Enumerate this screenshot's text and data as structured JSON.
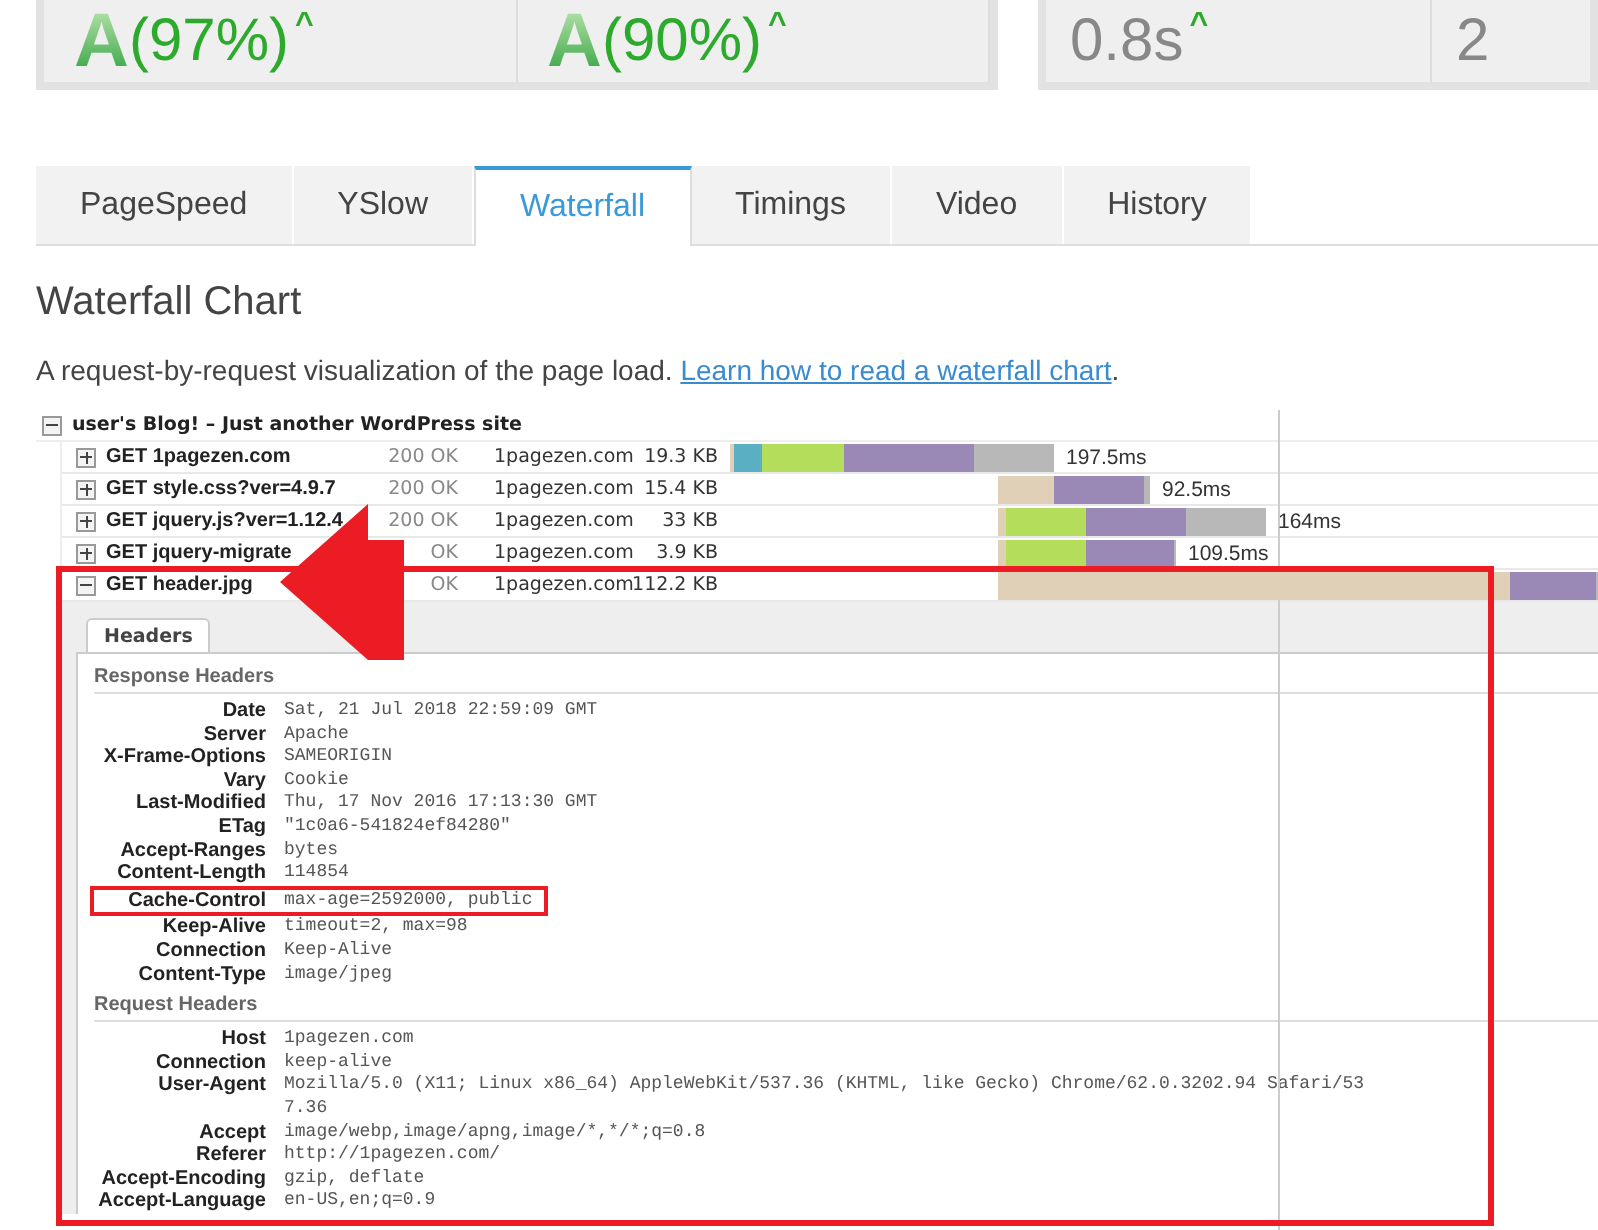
{
  "scores": [
    {
      "kind": "grade",
      "grade": "A",
      "value": "(97%)",
      "trend": "^"
    },
    {
      "kind": "grade",
      "grade": "A",
      "value": "(90%)",
      "trend": "^"
    },
    {
      "kind": "metric",
      "value": "0.8s",
      "trend": "^"
    },
    {
      "kind": "metric",
      "value": "2"
    }
  ],
  "tabs": [
    {
      "label": "PageSpeed",
      "selected": false
    },
    {
      "label": "YSlow",
      "selected": false
    },
    {
      "label": "Waterfall",
      "selected": true
    },
    {
      "label": "Timings",
      "selected": false
    },
    {
      "label": "Video",
      "selected": false
    },
    {
      "label": "History",
      "selected": false
    }
  ],
  "title": "Waterfall Chart",
  "description": {
    "text": "A request-by-request visualization of the page load. ",
    "link": "Learn how to read a waterfall chart",
    "after": "."
  },
  "waterfall": {
    "page": {
      "title": "user's Blog! – Just another WordPress site",
      "expanded": true
    },
    "rows": [
      {
        "name": "GET 1pagezen.com",
        "status": "200 OK",
        "domain": "1pagezen.com",
        "size": "19.3 KB",
        "duration": "197.5ms",
        "expanded": false
      },
      {
        "name": "GET style.css?ver=4.9.7",
        "status": "200 OK",
        "domain": "1pagezen.com",
        "size": "15.4 KB",
        "duration": "92.5ms",
        "expanded": false
      },
      {
        "name": "GET jquery.js?ver=1.12.4",
        "status": "200 OK",
        "domain": "1pagezen.com",
        "size": "33 KB",
        "duration": "164ms",
        "expanded": false
      },
      {
        "name": "GET jquery-migrate",
        "status": "OK",
        "domain": "1pagezen.com",
        "size": "3.9 KB",
        "duration": "109.5ms",
        "expanded": false
      },
      {
        "name": "GET header.jpg",
        "status": "OK",
        "domain": "1pagezen.com",
        "size": "112.2 KB",
        "expanded": true
      }
    ],
    "details": {
      "tabs": [
        {
          "label": "Headers",
          "selected": true
        }
      ],
      "sections": [
        {
          "title": "Response Headers",
          "headers": [
            {
              "name": "Date",
              "value": "Sat, 21 Jul 2018 22:59:09 GMT",
              "highlighted": false
            },
            {
              "name": "Server",
              "value": "Apache",
              "highlighted": false
            },
            {
              "name": "X-Frame-Options",
              "value": "SAMEORIGIN",
              "highlighted": false
            },
            {
              "name": "Vary",
              "value": "Cookie",
              "highlighted": false
            },
            {
              "name": "Last-Modified",
              "value": "Thu, 17 Nov 2016 17:13:30 GMT",
              "highlighted": false
            },
            {
              "name": "ETag",
              "value": "\"1c0a6-541824ef84280\"",
              "highlighted": false
            },
            {
              "name": "Accept-Ranges",
              "value": "bytes",
              "highlighted": false
            },
            {
              "name": "Content-Length",
              "value": "114854",
              "highlighted": false
            },
            {
              "name": "Cache-Control",
              "value": "max-age=2592000, public",
              "highlighted": true
            },
            {
              "name": "Keep-Alive",
              "value": "timeout=2, max=98",
              "highlighted": false
            },
            {
              "name": "Connection",
              "value": "Keep-Alive",
              "highlighted": false
            },
            {
              "name": "Content-Type",
              "value": "image/jpeg",
              "highlighted": false
            }
          ]
        },
        {
          "title": "Request Headers",
          "headers": [
            {
              "name": "Host",
              "value": "1pagezen.com",
              "highlighted": false
            },
            {
              "name": "Connection",
              "value": "keep-alive",
              "highlighted": false
            },
            {
              "name": "User-Agent",
              "value": "Mozilla/5.0 (X11; Linux x86_64) AppleWebKit/537.36 (KHTML, like Gecko) Chrome/62.0.3202.94 Safari/537.36",
              "highlighted": false
            },
            {
              "name": "Accept",
              "value": "image/webp,image/apng,image/*,*/*;q=0.8",
              "highlighted": false
            },
            {
              "name": "Referer",
              "value": "http://1pagezen.com/",
              "highlighted": false
            },
            {
              "name": "Accept-Encoding",
              "value": "gzip, deflate",
              "highlighted": false
            },
            {
              "name": "Accept-Language",
              "value": "en-US,en;q=0.9",
              "highlighted": false
            }
          ]
        }
      ]
    }
  }
}
